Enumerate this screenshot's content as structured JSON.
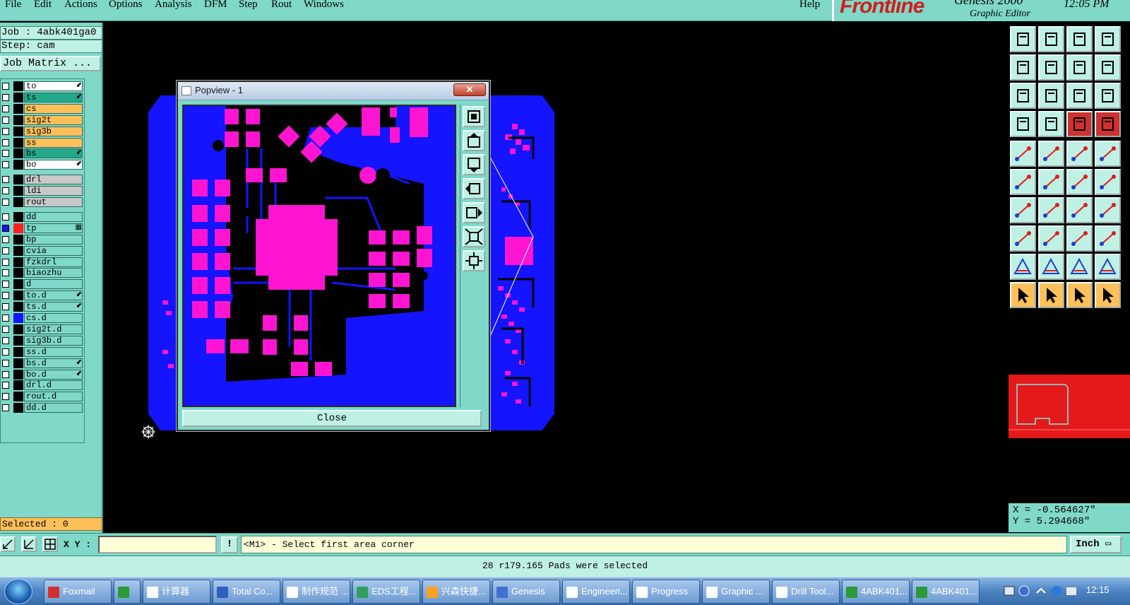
{
  "menu": [
    "File",
    "Edit",
    "Actions",
    "Options",
    "Analysis",
    "DFM",
    "Step",
    "Rout",
    "Windows"
  ],
  "help": "Help",
  "brand": {
    "logo": "Frontline",
    "product": "Genesis 2000",
    "subtitle": "Graphic Editor",
    "time": "12:05 PM"
  },
  "job": {
    "job_label": "Job : 4abk401ga0",
    "step_label": "Step: cam",
    "matrix_button": "Job Matrix ..."
  },
  "layers": [
    {
      "name": "to",
      "color": "#ffffff",
      "mark": "⬋"
    },
    {
      "name": "ts",
      "color": "#21a98a",
      "mark": "⬋"
    },
    {
      "name": "cs",
      "color": "#ffc05a",
      "mark": ""
    },
    {
      "name": "sig2t",
      "color": "#ffc05a",
      "mark": ""
    },
    {
      "name": "sig3b",
      "color": "#ffc05a",
      "mark": ""
    },
    {
      "name": "ss",
      "color": "#ffc05a",
      "mark": ""
    },
    {
      "name": "bs",
      "color": "#21a98a",
      "mark": "⬋"
    },
    {
      "name": "bo",
      "color": "#ffffff",
      "mark": "⬋"
    },
    {
      "name": "drl",
      "color": "#c8c8c8",
      "mark": ""
    },
    {
      "name": "ldi",
      "color": "#c8c8c8",
      "mark": ""
    },
    {
      "name": "rout",
      "color": "#c8c8c8",
      "mark": ""
    },
    {
      "name": "dd",
      "color": "#7fd8c8",
      "mark": ""
    },
    {
      "name": "tp",
      "color": "#7fd8c8",
      "mark": "▦",
      "swatch": "#ff2020",
      "active": true
    },
    {
      "name": "bp",
      "color": "#7fd8c8",
      "mark": ""
    },
    {
      "name": "cvia",
      "color": "#7fd8c8",
      "mark": ""
    },
    {
      "name": "fzkdrl",
      "color": "#7fd8c8",
      "mark": ""
    },
    {
      "name": "biaozhu",
      "color": "#7fd8c8",
      "mark": ""
    },
    {
      "name": "d",
      "color": "#7fd8c8",
      "mark": ""
    },
    {
      "name": "to.d",
      "color": "#7fd8c8",
      "mark": "⬋"
    },
    {
      "name": "ts.d",
      "color": "#7fd8c8",
      "mark": "⬋"
    },
    {
      "name": "cs.d",
      "color": "#7fd8c8",
      "mark": "",
      "swatch": "#1414ff"
    },
    {
      "name": "sig2t.d",
      "color": "#7fd8c8",
      "mark": ""
    },
    {
      "name": "sig3b.d",
      "color": "#7fd8c8",
      "mark": ""
    },
    {
      "name": "ss.d",
      "color": "#7fd8c8",
      "mark": ""
    },
    {
      "name": "bs.d",
      "color": "#7fd8c8",
      "mark": "⬋"
    },
    {
      "name": "bo.d",
      "color": "#7fd8c8",
      "mark": "⬋"
    },
    {
      "name": "drl.d",
      "color": "#7fd8c8",
      "mark": ""
    },
    {
      "name": "rout.d",
      "color": "#7fd8c8",
      "mark": ""
    },
    {
      "name": "dd.d",
      "color": "#7fd8c8",
      "mark": ""
    }
  ],
  "selected": "Selected : 0",
  "popup": {
    "title": "Popview - 1",
    "close": "Close",
    "close_x": "✕"
  },
  "coords": {
    "x": "X = -0.564627\"",
    "y": "Y = 5.294668\""
  },
  "cmd": {
    "xy_label": "X Y :",
    "xy_value": "",
    "bang": "!",
    "prompt": "<M1> - Select first area corner",
    "unit": "Inch"
  },
  "status": "28 r179.165 Pads were selected",
  "taskbar": {
    "tasks": [
      "Foxmail",
      "",
      "计算器",
      "Total Co...",
      "制作规范 ...",
      "EDS工程...",
      "兴森快捷...",
      "Genesis",
      "Engineeri...",
      "Progress",
      "Graphic ...",
      "Drill Tool...",
      "4ABK401...",
      "4ABK401..."
    ],
    "clock": "12:15"
  },
  "colors": {
    "panel": "#7fd8c8",
    "board": "#1414ff",
    "pad": "#ff14d2",
    "accent": "#ffc05a"
  }
}
